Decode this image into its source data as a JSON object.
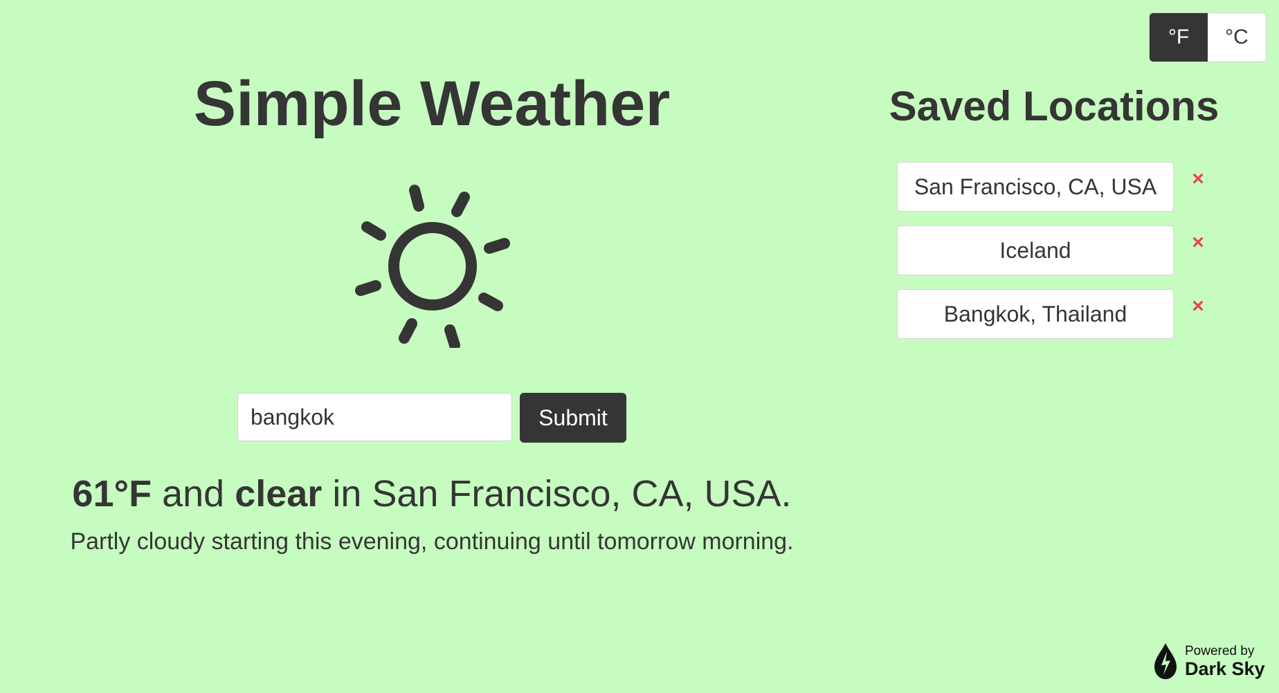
{
  "units": {
    "fahrenheit_label": "°F",
    "celsius_label": "°C",
    "active": "fahrenheit"
  },
  "app": {
    "title": "Simple Weather",
    "weather_icon": "sun-icon"
  },
  "search": {
    "value": "bangkok",
    "submit_label": "Submit"
  },
  "current": {
    "temperature": "61°F",
    "connector": " and ",
    "condition": "clear",
    "location_text": " in San Francisco, CA, USA.",
    "forecast": "Partly cloudy starting this evening, continuing until tomorrow morning."
  },
  "saved": {
    "title": "Saved Locations",
    "remove_glyph": "×",
    "items": [
      {
        "label": "San Francisco, CA, USA"
      },
      {
        "label": "Iceland"
      },
      {
        "label": "Bangkok, Thailand"
      }
    ]
  },
  "footer": {
    "powered_by": "Powered by",
    "brand": "Dark Sky",
    "brand_icon": "dark-sky-logo-icon"
  },
  "colors": {
    "background": "#c6fcbf",
    "text": "#353535",
    "active_button": "#353535",
    "remove": "#e8435a"
  }
}
